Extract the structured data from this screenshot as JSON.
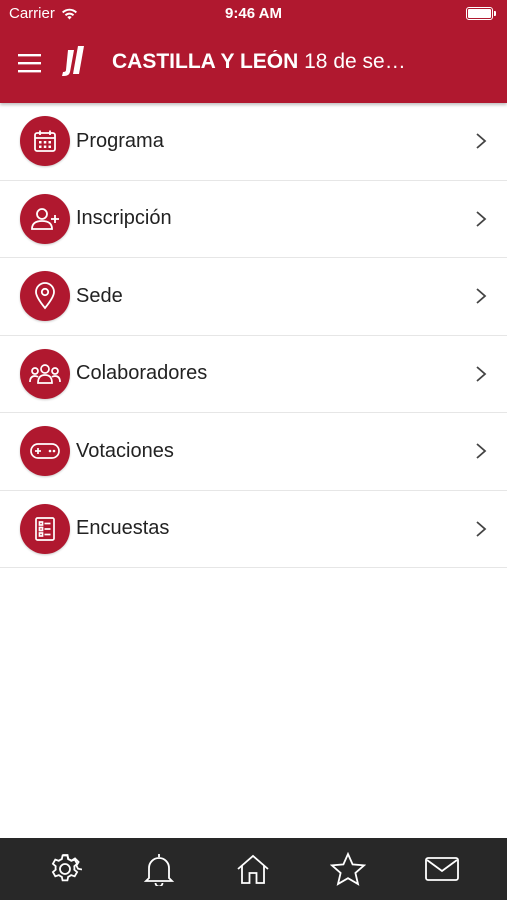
{
  "status_bar": {
    "carrier": "Carrier",
    "time": "9:46 AM"
  },
  "header": {
    "title_bold": "CASTILLA Y LEÓN",
    "title_rest": " 18 de se…",
    "color": "#b0182f"
  },
  "menu": [
    {
      "label": "Programa",
      "icon": "calendar-icon"
    },
    {
      "label": "Inscripción",
      "icon": "add-user-icon"
    },
    {
      "label": "Sede",
      "icon": "location-pin-icon"
    },
    {
      "label": "Colaboradores",
      "icon": "group-icon"
    },
    {
      "label": "Votaciones",
      "icon": "gamepad-icon"
    },
    {
      "label": "Encuestas",
      "icon": "checklist-icon"
    }
  ],
  "tabbar": {
    "items": [
      "gear-icon",
      "bell-icon",
      "home-icon",
      "star-icon",
      "mail-icon"
    ],
    "background": "#282828"
  }
}
